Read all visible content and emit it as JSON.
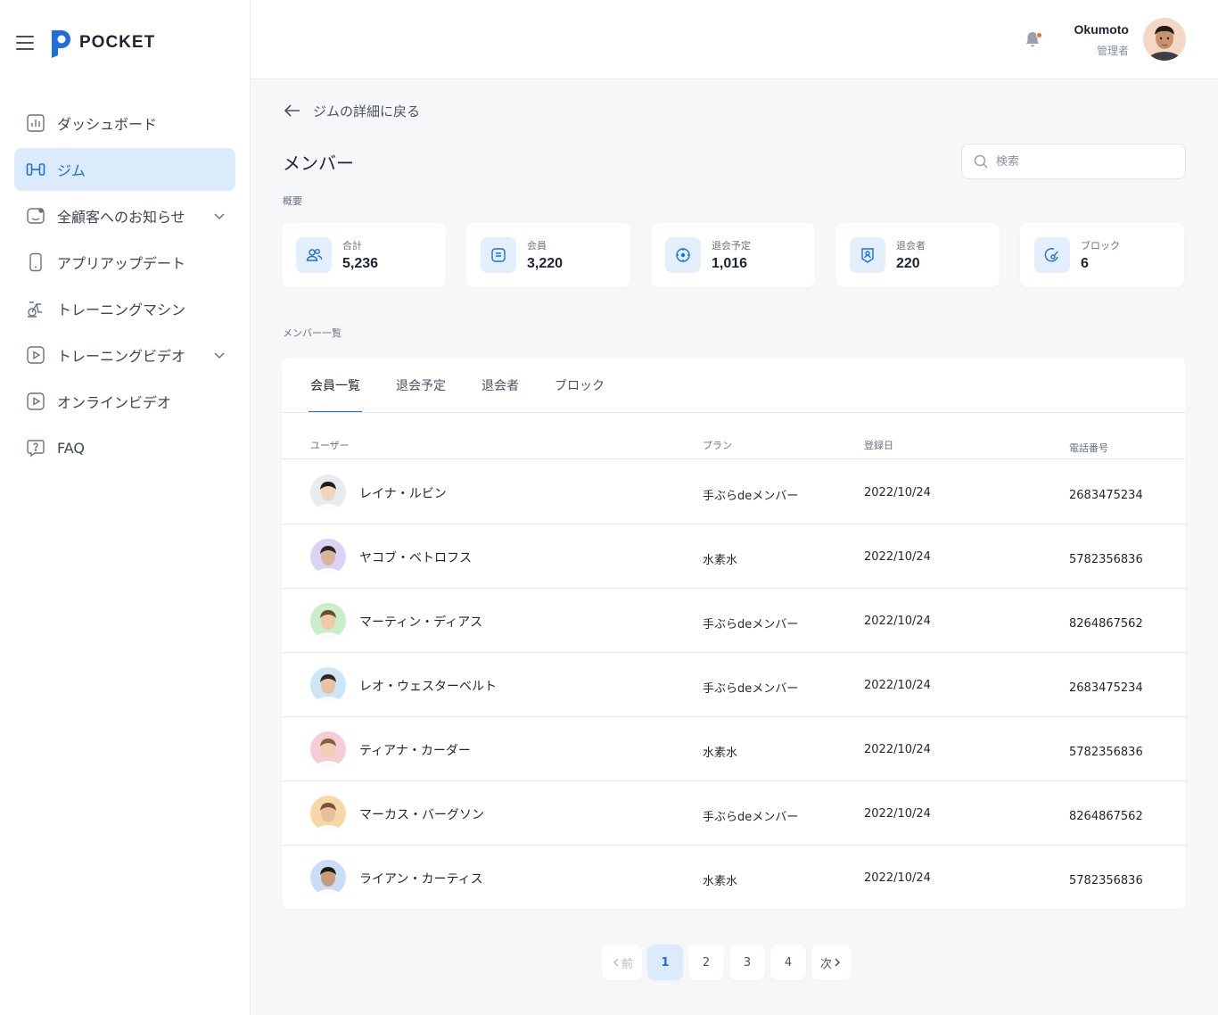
{
  "brand": {
    "name": "POCKET",
    "accent": "#1e6fd9"
  },
  "sidebar": {
    "items": [
      {
        "label": "ダッシュボード",
        "icon": "chart-icon"
      },
      {
        "label": "ジム",
        "icon": "dumbbell-icon",
        "active": true
      },
      {
        "label": "全顧客へのお知らせ",
        "icon": "announcement-icon",
        "expandable": true
      },
      {
        "label": "アプリアップデート",
        "icon": "phone-icon"
      },
      {
        "label": "トレーニングマシン",
        "icon": "exercise-bike-icon"
      },
      {
        "label": "トレーニングビデオ",
        "icon": "video-icon",
        "expandable": true
      },
      {
        "label": "オンラインビデオ",
        "icon": "video-icon"
      },
      {
        "label": "FAQ",
        "icon": "help-icon"
      }
    ]
  },
  "header": {
    "user_name": "Okumoto",
    "user_role": "管理者"
  },
  "main": {
    "back_label": "ジムの詳細に戻る",
    "title": "メンバー",
    "search_placeholder": "検索",
    "overview_label": "概要",
    "list_label": "メンバー一覧"
  },
  "stats": [
    {
      "label": "合計",
      "value": "5,236",
      "icon": "users-icon"
    },
    {
      "label": "会員",
      "value": "3,220",
      "icon": "member-card-icon"
    },
    {
      "label": "退会予定",
      "value": "1,016",
      "icon": "clock-icon"
    },
    {
      "label": "退会者",
      "value": "220",
      "icon": "badge-icon"
    },
    {
      "label": "ブロック",
      "value": "6",
      "icon": "block-icon"
    }
  ],
  "tabs": [
    {
      "label": "会員一覧",
      "active": true
    },
    {
      "label": "退会予定"
    },
    {
      "label": "退会者"
    },
    {
      "label": "ブロック"
    }
  ],
  "table": {
    "headers": {
      "user": "ユーザー",
      "plan": "プラン",
      "date": "登録日",
      "phone": "電話番号"
    },
    "rows": [
      {
        "name": "レイナ・ルビン",
        "plan": "手ぶらdeメンバー",
        "date": "2022/10/24",
        "phone": "2683475234",
        "avatar_bg": "#e9ecef"
      },
      {
        "name": "ヤコブ・ベトロフス",
        "plan": "水素水",
        "date": "2022/10/24",
        "phone": "5782356836",
        "avatar_bg": "#d9d4f5"
      },
      {
        "name": "マーティン・ディアス",
        "plan": "手ぶらdeメンバー",
        "date": "2022/10/24",
        "phone": "8264867562",
        "avatar_bg": "#c8efc9"
      },
      {
        "name": "レオ・ウェスターベルト",
        "plan": "手ぶらdeメンバー",
        "date": "2022/10/24",
        "phone": "2683475234",
        "avatar_bg": "#cde6f7"
      },
      {
        "name": "ティアナ・カーダー",
        "plan": "水素水",
        "date": "2022/10/24",
        "phone": "5782356836",
        "avatar_bg": "#f6cdd6"
      },
      {
        "name": "マーカス・バーグソン",
        "plan": "手ぶらdeメンバー",
        "date": "2022/10/24",
        "phone": "8264867562",
        "avatar_bg": "#f7d7a8"
      },
      {
        "name": "ライアン・カーティス",
        "plan": "水素水",
        "date": "2022/10/24",
        "phone": "5782356836",
        "avatar_bg": "#c9ddf6"
      }
    ]
  },
  "pagination": {
    "prev": "前",
    "next": "次",
    "pages": [
      "1",
      "2",
      "3",
      "4"
    ],
    "current": "1"
  }
}
